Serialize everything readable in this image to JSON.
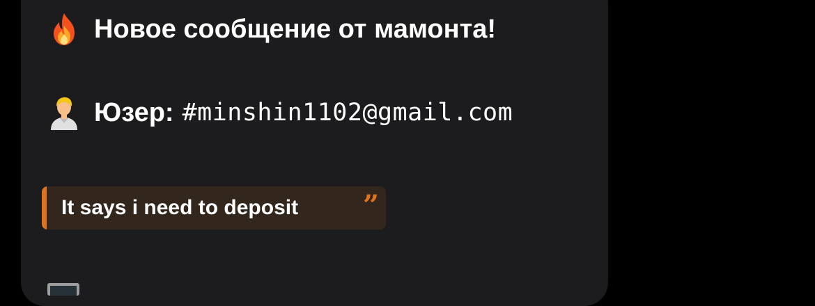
{
  "message": {
    "title": "Новое сообщение от мамонта!",
    "title_icon": "fire-icon",
    "user_label": "Юзер:",
    "user_icon": "person-icon",
    "user_value": "#minshin1102@gmail.com",
    "quote_text": "It says i need to deposit",
    "quote_icon": "quote-mark-icon",
    "next_line_icon": "laptop-icon"
  },
  "colors": {
    "background": "#000000",
    "bubble": "#1c1c1e",
    "accent": "#e0731e",
    "quote_background": "#33261c",
    "text": "#ffffff"
  }
}
